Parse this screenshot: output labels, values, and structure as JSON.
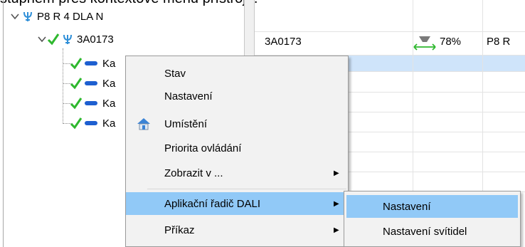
{
  "doc_text": "stupném přes kontextové menu přístroje.",
  "tree": {
    "root": {
      "label": "P8 R 4 DLA N"
    },
    "device": {
      "label": "3A0173"
    },
    "children": [
      "Ka",
      "Ka",
      "Ka",
      "Ka"
    ]
  },
  "grid": {
    "row1": {
      "name": "3A0173",
      "percent": "78%",
      "location": "P8 R"
    }
  },
  "context_menu": {
    "items": [
      {
        "label": "Stav"
      },
      {
        "label": "Nastavení"
      },
      {
        "label": "Umístění",
        "icon": "house-icon"
      },
      {
        "label": "Priorita ovládání"
      },
      {
        "label": "Zobrazit v ...",
        "submenu": true
      },
      {
        "label": "Aplikační řadič DALI",
        "submenu": true,
        "highlighted": true
      },
      {
        "label": "Příkaz",
        "submenu": true
      }
    ]
  },
  "submenu": {
    "items": [
      {
        "label": "Nastavení",
        "highlighted": true
      },
      {
        "label": "Nastavení svítidel"
      }
    ]
  },
  "colors": {
    "selection": "#cfe4fa",
    "menu_highlight": "#91c9f7",
    "check_green": "#2eb82e",
    "fork_blue": "#2f8fd8",
    "lamp_blue": "#1e5fd0"
  }
}
